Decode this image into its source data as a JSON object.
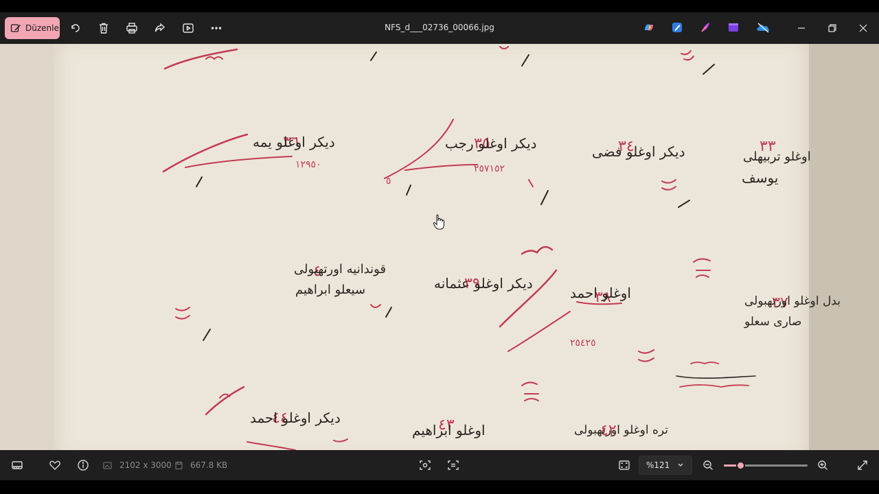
{
  "titlebar": {
    "edit_label": "Düzenle",
    "filename": "NFS_d___02736_00066.jpg",
    "toolbar_icons": [
      "rotate-icon",
      "delete-icon",
      "print-icon",
      "share-icon",
      "slideshow-icon",
      "more-icon"
    ],
    "app_icons": [
      "copilot-icon",
      "photos-edit-icon",
      "designer-icon",
      "clipchamp-icon",
      "onedrive-icon"
    ]
  },
  "document": {
    "entries": [
      {
        "number": "٣٦",
        "text": "دیکر اوغلو یمه"
      },
      {
        "number": "٣٥",
        "text": "دیکر اوغلو رجب"
      },
      {
        "number": "٣٤",
        "text": "دیکر اوغلو فضی"
      },
      {
        "number": "٣٣",
        "text": "اوغلو تربیهلی یوسف"
      },
      {
        "number": "٤٠",
        "text": "قوندانیه اورتهبولی سیعلو ابراهیم"
      },
      {
        "number": "٣٩",
        "text": "دیکر اوغلو عثمانه"
      },
      {
        "number": "٣٨",
        "text": "اوغلو احمد"
      },
      {
        "number": "٣٧",
        "text": "بدل اوغلو اورتهبولی صاری سعلو"
      },
      {
        "number": "٤٤",
        "text": "دیکر اوغلو احمد"
      },
      {
        "number": "٤٣",
        "text": "اوغلو ابراهیم"
      },
      {
        "number": "٤٢",
        "text": "تره اوغلو اورتهبولی"
      }
    ]
  },
  "statusbar": {
    "dimensions": "2102 x 3000",
    "filesize": "667.8 KB",
    "zoom": "%121",
    "zoom_fraction": 0.2
  },
  "colors": {
    "accent": "#f2a6b4",
    "ink_black": "#2a2420",
    "ink_red": "#c23a52",
    "paper": "#ece6da"
  }
}
